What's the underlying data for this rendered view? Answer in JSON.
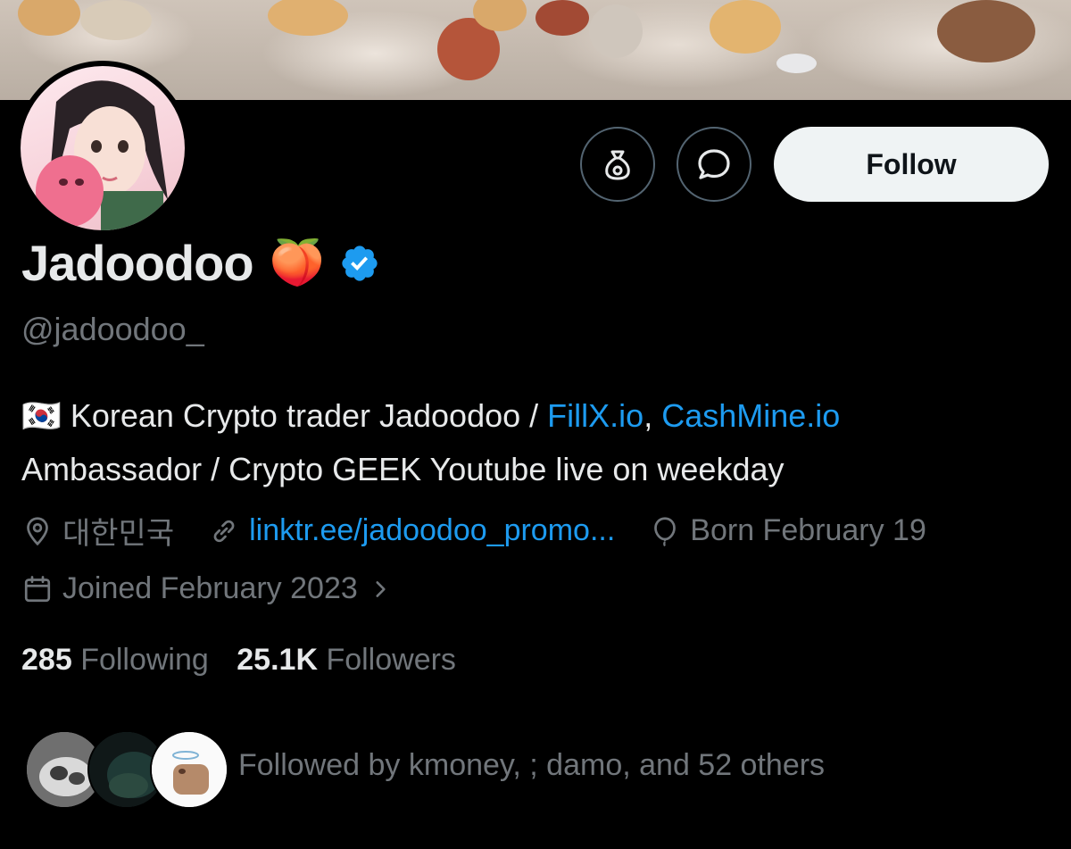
{
  "profile": {
    "display_name": "Jadoodoo",
    "name_emoji": "🍑",
    "handle": "@jadoodoo_",
    "bio": {
      "flag": "🇰🇷",
      "text_1": " Korean Crypto trader Jadoodoo / ",
      "link_1": "FillX.io",
      "sep": ", ",
      "link_2": "CashMine.io",
      "text_2": "Ambassador / Crypto GEEK Youtube live on weekday"
    },
    "location": "대한민국",
    "website": "linktr.ee/jadoodoo_promo...",
    "birthday": "Born February 19",
    "joined": "Joined February 2023",
    "following_count": "285",
    "following_label": "Following",
    "followers_count": "25.1K",
    "followers_label": "Followers",
    "followed_by": "Followed by kmoney, ; damo, and 52 others"
  },
  "actions": {
    "follow_label": "Follow",
    "tip_icon": "money-bag-icon",
    "message_icon": "message-bubble-icon"
  },
  "colors": {
    "background": "#000000",
    "text_primary": "#e7e9ea",
    "text_secondary": "#71767b",
    "link": "#1d9bf0",
    "verified": "#1d9bf0",
    "follow_button_bg": "#eff3f4"
  }
}
